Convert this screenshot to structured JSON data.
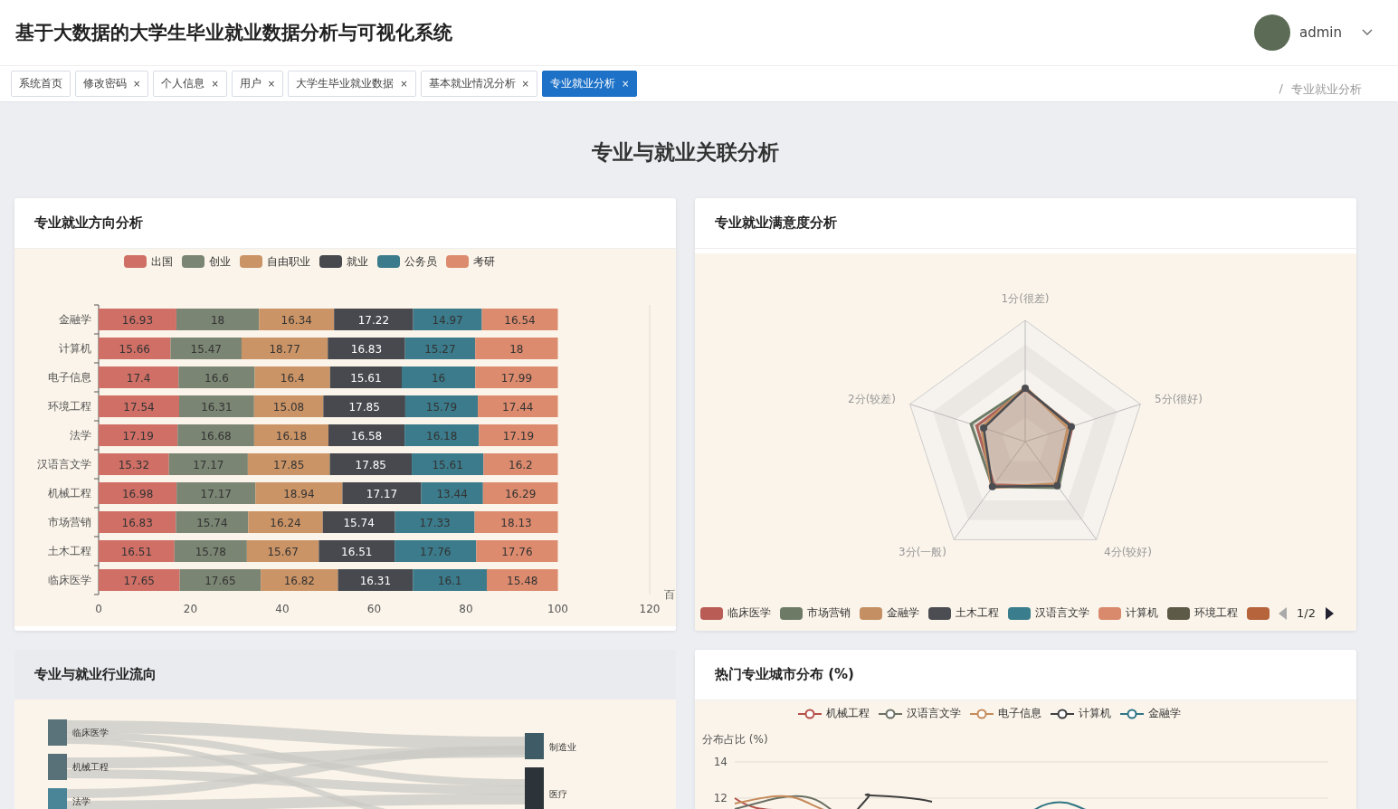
{
  "header": {
    "title": "基于大数据的大学生毕业就业数据分析与可视化系统",
    "user": "admin"
  },
  "tabs": [
    {
      "label": "系统首页",
      "selected": false
    },
    {
      "label": "修改密码",
      "close": "×",
      "selected": false
    },
    {
      "label": "个人信息",
      "close": "×",
      "selected": false
    },
    {
      "label": "用户",
      "close": "×",
      "selected": false
    },
    {
      "label": "大学生毕业就业数据",
      "close": "×",
      "selected": false
    },
    {
      "label": "基本就业情况分析",
      "close": "×",
      "selected": false
    },
    {
      "label": "专业就业分析",
      "close": "×",
      "selected": true
    }
  ],
  "breadcrumb": {
    "separator": "/",
    "current": "专业就业分析"
  },
  "page_title": "专业与就业关联分析",
  "direction_card": {
    "title": "专业就业方向分析",
    "chart_data": {
      "type": "bar",
      "orientation": "horizontal",
      "stacked": true,
      "data_labels": true,
      "xlabel": "百",
      "categories": [
        "金融学",
        "计算机",
        "电子信息",
        "环境工程",
        "法学",
        "汉语言文学",
        "机械工程",
        "市场营销",
        "土木工程",
        "临床医学"
      ],
      "xlim": [
        0,
        120
      ],
      "xticks": [
        0,
        20,
        40,
        60,
        80,
        100,
        120
      ],
      "series": [
        {
          "name": "出国",
          "color": "#cf6f66",
          "values": [
            16.93,
            15.66,
            17.4,
            17.54,
            17.19,
            15.32,
            16.98,
            16.83,
            16.51,
            17.65
          ]
        },
        {
          "name": "创业",
          "color": "#7b8573",
          "values": [
            18,
            15.47,
            16.6,
            16.31,
            16.68,
            17.17,
            17.17,
            15.74,
            15.78,
            17.65
          ]
        },
        {
          "name": "自由职业",
          "color": "#cb9466",
          "values": [
            16.34,
            18.77,
            16.4,
            15.08,
            16.18,
            17.85,
            18.94,
            16.24,
            15.67,
            16.82
          ]
        },
        {
          "name": "就业",
          "color": "#47494e",
          "values": [
            17.22,
            16.83,
            15.61,
            17.85,
            16.58,
            17.85,
            17.17,
            15.74,
            16.51,
            16.31
          ]
        },
        {
          "name": "公务员",
          "color": "#3b7b8b",
          "values": [
            14.97,
            15.27,
            16,
            15.79,
            16.18,
            15.61,
            13.44,
            17.33,
            17.76,
            16.1
          ]
        },
        {
          "name": "考研",
          "color": "#dc8b6e",
          "values": [
            16.54,
            18,
            17.99,
            17.44,
            17.19,
            16.2,
            16.29,
            18.13,
            17.76,
            15.48
          ]
        }
      ]
    }
  },
  "satisfaction_card": {
    "title": "专业就业满意度分析",
    "indicators": [
      "1分(很差)",
      "5分(很好)",
      "4分(较好)",
      "3分(一般)",
      "2分(较差)"
    ],
    "legend": [
      {
        "label": "临床医学",
        "color": "#b85c55"
      },
      {
        "label": "市场营销",
        "color": "#6d7b66"
      },
      {
        "label": "金融学",
        "color": "#c38f63"
      },
      {
        "label": "土木工程",
        "color": "#4b4d52"
      },
      {
        "label": "汉语言文学",
        "color": "#3a7d8c"
      },
      {
        "label": "计算机",
        "color": "#d9896c"
      },
      {
        "label": "环境工程",
        "color": "#5d5a48"
      },
      {
        "color": "#b5643c"
      }
    ],
    "page": "1/2"
  },
  "flow_card": {
    "title": "专业与就业行业流向",
    "sources": [
      {
        "label": "临床医学",
        "color": "#5a737a"
      },
      {
        "label": "机械工程",
        "color": "#587077"
      },
      {
        "label": "法学",
        "color": "#4a8597"
      }
    ],
    "targets": [
      {
        "label": "制造业",
        "color": "#3f5c66"
      },
      {
        "label": "医疗",
        "color": "#2c3439"
      }
    ]
  },
  "city_card": {
    "title": "热门专业城市分布 (%)",
    "y_axis_label": "分布占比 (%)",
    "y_ticks": [
      "14",
      "12"
    ],
    "legend": [
      {
        "label": "机械工程",
        "color": "#b5504a"
      },
      {
        "label": "汉语言文学",
        "color": "#6b7065"
      },
      {
        "label": "电子信息",
        "color": "#c58a5a"
      },
      {
        "label": "计算机",
        "color": "#3f3f3f"
      },
      {
        "label": "金融学",
        "color": "#2f7584"
      }
    ]
  }
}
